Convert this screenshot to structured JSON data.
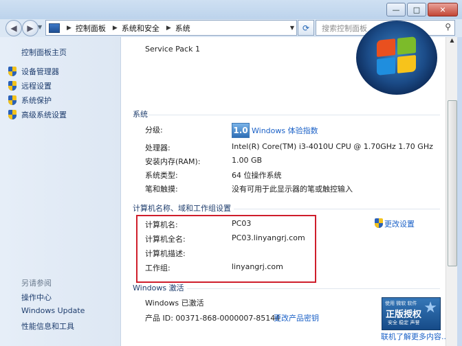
{
  "window": {
    "minimize": "—",
    "maximize": "□",
    "close": "✕"
  },
  "address": {
    "back_icon": "back-arrow-icon",
    "forward_icon": "forward-arrow-icon",
    "crumbs": [
      "控制面板",
      "系统和安全",
      "系统"
    ],
    "refresh_icon": "refresh-icon",
    "search_placeholder": "搜索控制面板"
  },
  "sidebar": {
    "home": "控制面板主页",
    "items": [
      {
        "label": "设备管理器",
        "icon": "shield-icon"
      },
      {
        "label": "远程设置",
        "icon": "shield-icon"
      },
      {
        "label": "系统保护",
        "icon": "shield-icon"
      },
      {
        "label": "高级系统设置",
        "icon": "shield-icon"
      }
    ],
    "see_also": "另请参阅",
    "see_also_links": [
      "操作中心",
      "Windows Update",
      "性能信息和工具"
    ]
  },
  "main": {
    "service_pack": "Service Pack 1",
    "system": {
      "heading": "系统",
      "rating_label": "分级:",
      "wei_score": "1.0",
      "wei_link": "Windows 体验指数",
      "rows": [
        {
          "label": "处理器:",
          "value": "Intel(R) Core(TM) i3-4010U CPU @ 1.70GHz   1.70 GHz"
        },
        {
          "label": "安装内存(RAM):",
          "value": "1.00 GB"
        },
        {
          "label": "系统类型:",
          "value": "64 位操作系统"
        },
        {
          "label": "笔和触摸:",
          "value": "没有可用于此显示器的笔或触控输入"
        }
      ]
    },
    "computer": {
      "heading": "计算机名称、域和工作组设置",
      "change_settings": "更改设置",
      "rows": [
        {
          "label": "计算机名:",
          "value": "PC03"
        },
        {
          "label": "计算机全名:",
          "value": "PC03.linyangrj.com"
        },
        {
          "label": "计算机描述:",
          "value": ""
        },
        {
          "label": "工作组:",
          "value": "linyangrj.com"
        }
      ]
    },
    "activation": {
      "heading": "Windows 激活",
      "status": "Windows 已激活",
      "product_id": "产品 ID: 00371-868-0000007-85144",
      "change_key": "更改产品密钥",
      "genuine_small": "使用 微软 软件",
      "genuine_big": "正版授权",
      "genuine_sub": "安全 稳定 声誉",
      "learn_more": "联机了解更多内容..."
    }
  },
  "colors": {
    "link": "#1b61c7",
    "highlight_box": "#cf1d2a"
  }
}
